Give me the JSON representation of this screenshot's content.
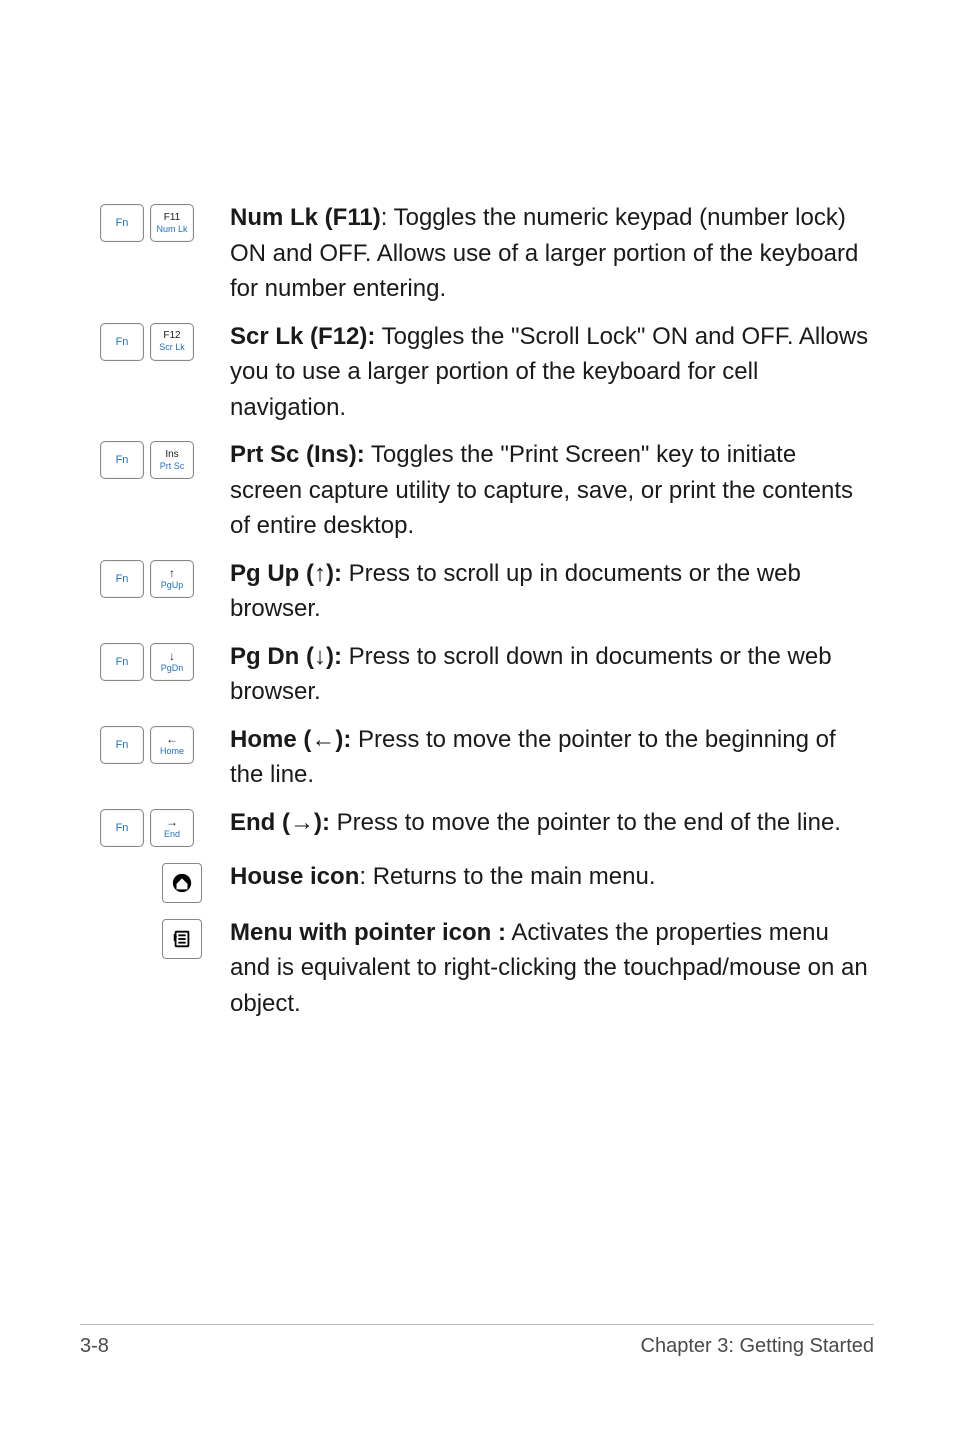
{
  "keys": {
    "fn": "Fn",
    "f11_top": "F11",
    "f11_bot": "Num Lk",
    "f12_top": "F12",
    "f12_bot": "Scr Lk",
    "ins_top": "Ins",
    "ins_bot": "Prt Sc",
    "pgup_bot": "PgUp",
    "pgdn_bot": "PgDn",
    "home_bot": "Home",
    "end_bot": "End"
  },
  "rows": {
    "numlk": {
      "lead": "Num Lk (F11)",
      "rest": ": Toggles the numeric keypad (number lock) ON and OFF. Allows use of a larger portion of the keyboard for number entering."
    },
    "scrlk": {
      "lead": "Scr Lk (F12):",
      "rest": " Toggles the \"Scroll Lock\" ON and OFF. Allows you to use a larger portion of the keyboard for cell navigation."
    },
    "prtsc": {
      "lead": "Prt Sc (Ins):",
      "rest": " Toggles the \"Print Screen\" key to initiate screen capture utility to capture, save, or print the contents of entire desktop."
    },
    "pgup": {
      "lead": "Pg Up (↑):",
      "rest": " Press to scroll up in documents or the web browser."
    },
    "pgdn": {
      "lead": "Pg Dn (↓):",
      "rest": " Press to scroll down in documents or the web browser."
    },
    "home": {
      "lead": "Home (←):",
      "rest": " Press to move the pointer to the beginning of the line."
    },
    "end": {
      "lead": "End (→):",
      "rest": " Press to move the pointer to the end of the line."
    },
    "house": {
      "lead": "House icon",
      "rest": ": Returns to the main menu."
    },
    "menu": {
      "lead": "Menu with pointer icon :",
      "rest": " Activates the properties menu and is equivalent to right-clicking the touchpad/mouse on an object."
    }
  },
  "footer": {
    "left": "3-8",
    "right": "Chapter 3: Getting Started"
  }
}
